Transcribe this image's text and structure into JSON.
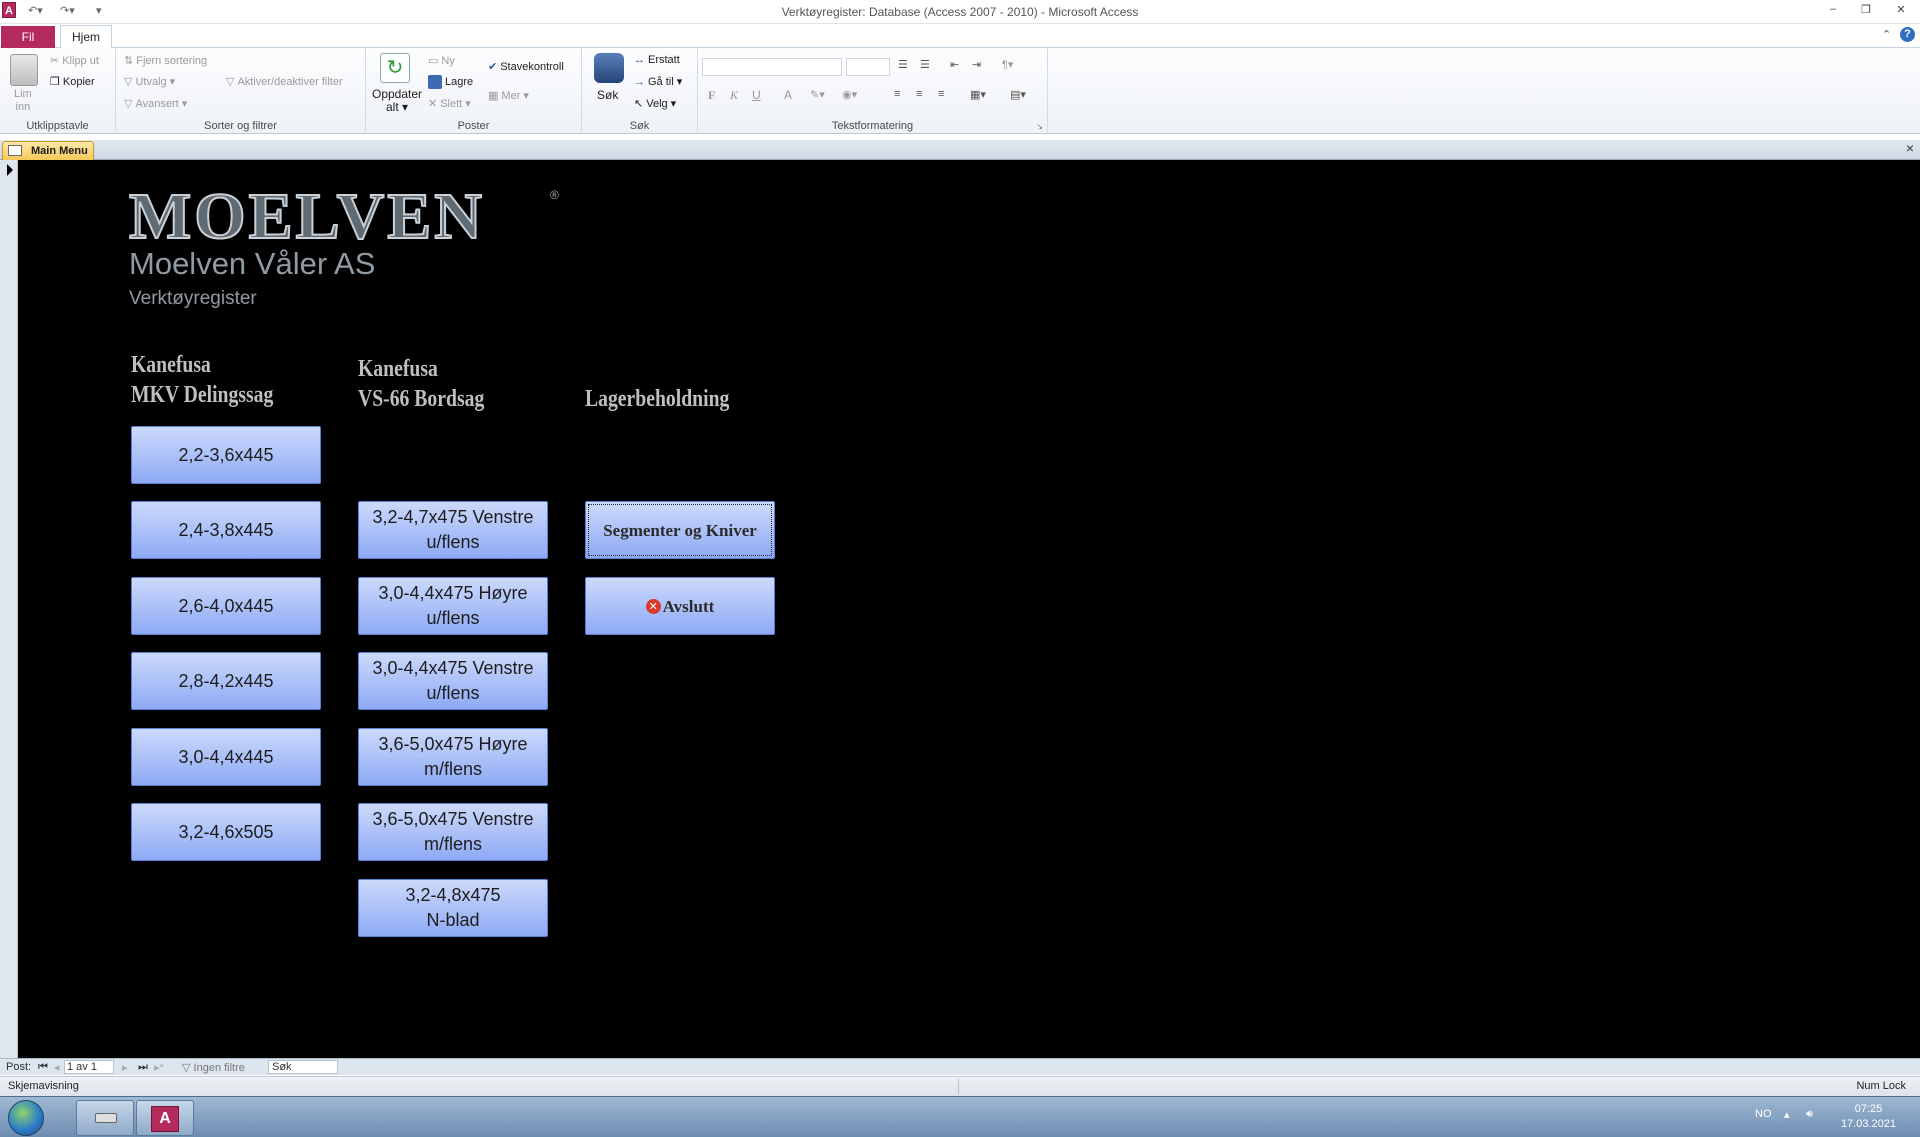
{
  "window": {
    "title": "Verktøyregister: Database (Access 2007 - 2010)  -  Microsoft Access",
    "app_icon_letter": "A",
    "help_glyph": "?"
  },
  "ribbon": {
    "tabs": [
      "Fil",
      "Hjem"
    ],
    "clipboard": {
      "paste": "Lim",
      "paste2": "inn",
      "cut": "Klipp ut",
      "copy": "Kopier",
      "label": "Utklippstavle"
    },
    "sort_filter": {
      "remove_sort": "Fjern sortering",
      "selection": "Utvalg",
      "advanced": "Avansert",
      "toggle_filter": "Aktiver/deaktiver filter",
      "label": "Sorter og filtrer"
    },
    "records": {
      "refresh": "Oppdater",
      "refresh2": "alt",
      "new": "Ny",
      "save": "Lagre",
      "delete": "Slett",
      "spelling": "Stavekontroll",
      "more": "Mer",
      "label": "Poster"
    },
    "find": {
      "find": "Søk",
      "replace": "Erstatt",
      "goto": "Gå til",
      "select": "Velg",
      "label": "Søk"
    },
    "text_format": {
      "bold": "F",
      "italic": "K",
      "underline": "U",
      "font_color": "A",
      "label": "Tekstformatering"
    }
  },
  "document": {
    "tab_label": "Main Menu",
    "close_glyph": "×"
  },
  "form": {
    "logo": "MOELVEN",
    "logo_reg": "®",
    "company": "Moelven Våler AS",
    "subtitle": "Verktøyregister",
    "columns": [
      {
        "heading": [
          "Kanefusa",
          "MKV Delingssag"
        ],
        "buttons": [
          [
            "2,2-3,6x445"
          ],
          [
            "2,4-3,8x445"
          ],
          [
            "2,6-4,0x445"
          ],
          [
            "2,8-4,2x445"
          ],
          [
            "3,0-4,4x445"
          ],
          [
            "3,2-4,6x505"
          ]
        ]
      },
      {
        "heading": [
          "Kanefusa",
          "VS-66 Bordsag"
        ],
        "buttons": [
          [
            "3,2-4,7x475 Venstre",
            "u/flens"
          ],
          [
            "3,0-4,4x475 Høyre",
            "u/flens"
          ],
          [
            "3,0-4,4x475 Venstre",
            "u/flens"
          ],
          [
            "3,6-5,0x475 Høyre",
            "m/flens"
          ],
          [
            "3,6-5,0x475 Venstre",
            "m/flens"
          ],
          [
            "3,2-4,8x475",
            "N-blad"
          ]
        ]
      },
      {
        "heading": [
          "Lagerbeholdning"
        ],
        "segments_button": "Segmenter og Kniver",
        "exit_button": "Avslutt",
        "exit_icon": "close-circle-icon"
      }
    ]
  },
  "navbar": {
    "label": "Post:",
    "record": "1 av 1",
    "filter": "Ingen filtre",
    "search": "Søk"
  },
  "statusbar": {
    "view": "Skjemavisning",
    "numlock": "Num Lock"
  },
  "taskbar": {
    "lang": "NO",
    "time": "07:25",
    "date": "17.03.2021"
  }
}
